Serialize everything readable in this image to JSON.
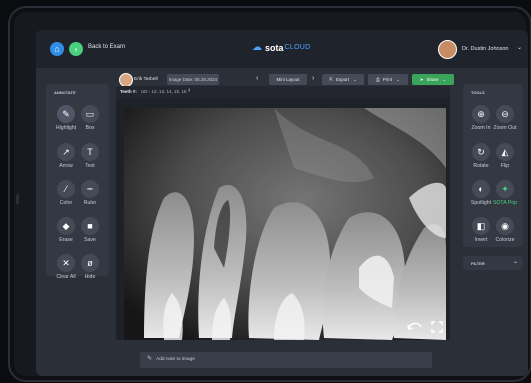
{
  "header": {
    "back_label": "Back to Exam",
    "brand_text": "sota",
    "brand_suffix": "CLOUD",
    "user_name": "Dr. Dustin Johnson"
  },
  "subheader": {
    "patient_name": "Erik Tarbell",
    "image_date": "Image Date: 05.28.2024",
    "layout_label": "Mini Layout",
    "export_label": "Export",
    "print_label": "Print",
    "share_label": "Share"
  },
  "image_bar": {
    "teeth_label": "Teeth #:",
    "teeth_value": "UD - 12, 13, 14, 15, 16"
  },
  "annotate": {
    "title": "ANNOTATE",
    "tools": [
      {
        "label": "Highlight",
        "icon": "highlight-icon"
      },
      {
        "label": "Box",
        "icon": "box-icon"
      },
      {
        "label": "Arrow",
        "icon": "arrow-icon"
      },
      {
        "label": "Text",
        "icon": "text-icon"
      },
      {
        "label": "Color",
        "icon": "color-icon"
      },
      {
        "label": "Ruler",
        "icon": "ruler-icon"
      },
      {
        "label": "Erase",
        "icon": "erase-icon"
      },
      {
        "label": "Save",
        "icon": "save-icon"
      },
      {
        "label": "Clear All",
        "icon": "clear-all-icon"
      },
      {
        "label": "Hide",
        "icon": "hide-icon"
      }
    ]
  },
  "tools": {
    "title": "TOOLS",
    "items": [
      {
        "label": "Zoom In",
        "icon": "zoom-in-icon"
      },
      {
        "label": "Zoom Out",
        "icon": "zoom-out-icon"
      },
      {
        "label": "Rotate",
        "icon": "rotate-icon"
      },
      {
        "label": "Flip",
        "icon": "flip-icon"
      },
      {
        "label": "Spotlight",
        "icon": "spotlight-icon"
      },
      {
        "label": "SOTA Pop",
        "icon": "sota-pop-icon",
        "color": "#48d07c"
      },
      {
        "label": "Invert",
        "icon": "invert-icon"
      },
      {
        "label": "Colorize",
        "icon": "colorize-icon"
      }
    ]
  },
  "filter": {
    "label": "FILTER"
  },
  "notes": {
    "placeholder": "Add note to image"
  },
  "colors": {
    "accent_green": "#48d07c",
    "accent_blue": "#2f8de6",
    "share_button": "#3aa45a"
  }
}
